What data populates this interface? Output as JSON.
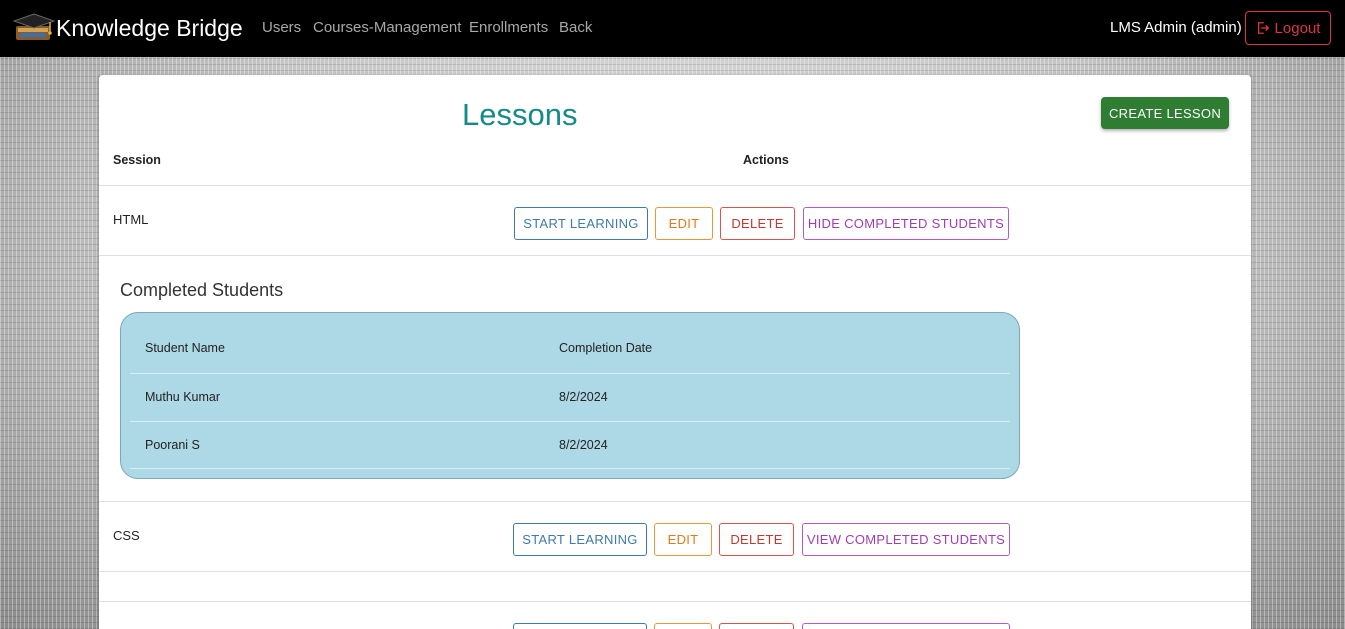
{
  "navbar": {
    "brand": "Knowledge Bridge",
    "links": [
      "Users",
      "Courses-Management",
      "Enrollments",
      "Back"
    ],
    "user": "LMS Admin (admin)",
    "logout": "Logout"
  },
  "page": {
    "title": "Lessons",
    "create_button": "CREATE LESSON",
    "columns": [
      "Session",
      "Actions"
    ]
  },
  "lessons": [
    {
      "session": "HTML",
      "actions": [
        "START LEARNING",
        "EDIT",
        "DELETE",
        "HIDE COMPLETED STUDENTS"
      ]
    },
    {
      "session": "CSS",
      "actions": [
        "START LEARNING",
        "EDIT",
        "DELETE",
        "VIEW COMPLETED STUDENTS"
      ]
    }
  ],
  "completed": {
    "title": "Completed Students",
    "columns": [
      "Student Name",
      "Completion Date"
    ],
    "rows": [
      {
        "name": "Muthu Kumar",
        "date": "8/2/2024"
      },
      {
        "name": "Poorani S",
        "date": "8/2/2024"
      }
    ]
  },
  "colors": {
    "navbar_bg": "#000000",
    "title": "#168a8a",
    "create_button": "#2e7d32",
    "completed_bg": "#add8e6"
  }
}
